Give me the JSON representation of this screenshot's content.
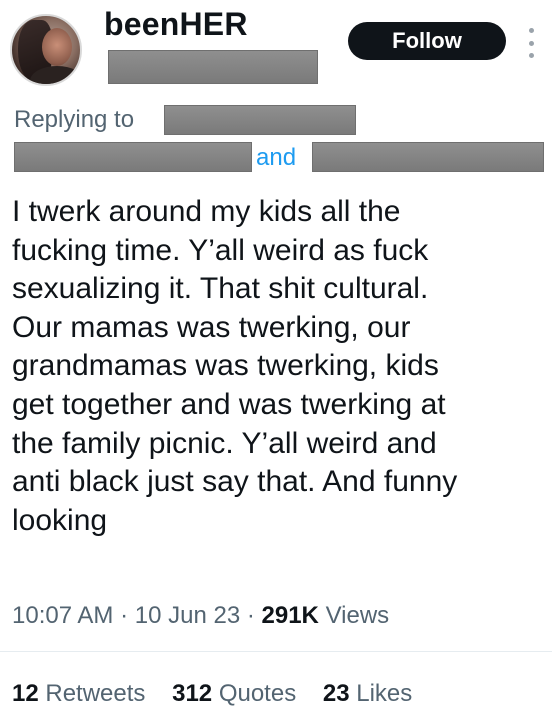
{
  "author": {
    "display_name": "beenHER",
    "avatar_icon": "profile-photo"
  },
  "follow_label": "Follow",
  "reply": {
    "replying_to_label": "Replying to",
    "and_label": "and"
  },
  "tweet": {
    "lines": [
      "I twerk around my kids all the",
      "fucking time. Y’all weird as fuck",
      "sexualizing it. That shit cultural.",
      "Our mamas was twerking, our",
      "grandmamas was twerking, kids",
      "get together and was twerking at",
      "the family picnic. Y’all weird and",
      "anti black just say that. And funny",
      "looking"
    ]
  },
  "meta": {
    "time": "10:07 AM",
    "date": "10 Jun 23",
    "views_count": "291K",
    "views_label": "Views"
  },
  "stats": {
    "retweets_count": "12",
    "retweets_label": "Retweets",
    "quotes_count": "312",
    "quotes_label": "Quotes",
    "likes_count": "23",
    "likes_label": "Likes"
  },
  "colors": {
    "text": "#0f1419",
    "secondary": "#536471",
    "link": "#1d9bf0",
    "button_bg": "#0f1419",
    "redaction": "#808080"
  }
}
